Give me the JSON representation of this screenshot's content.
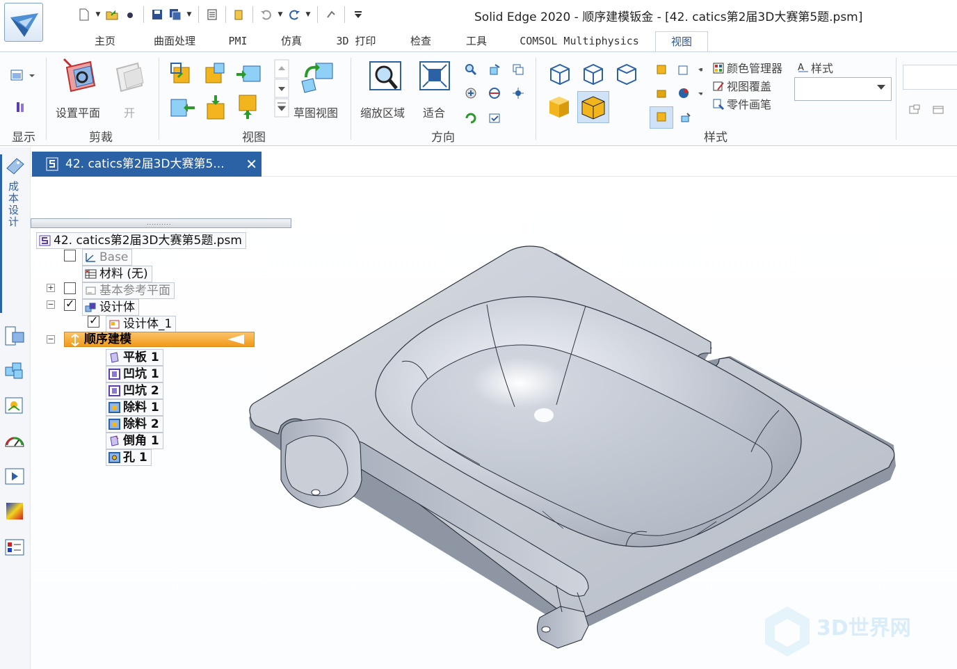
{
  "window": {
    "title": "Solid Edge 2020 - 顺序建模钣金 - [42. catics第2届3D大赛第5题.psm]"
  },
  "ribbon_tabs": [
    {
      "label": "主页"
    },
    {
      "label": "曲面处理"
    },
    {
      "label": "PMI"
    },
    {
      "label": "仿真"
    },
    {
      "label": "3D 打印"
    },
    {
      "label": "检查"
    },
    {
      "label": "工具"
    },
    {
      "label": "COMSOL Multiphysics"
    },
    {
      "label": "视图",
      "active": true
    }
  ],
  "ribbon": {
    "groups": {
      "display": "显示",
      "clip": "剪裁",
      "views": "视图",
      "orient": "方向",
      "style": "样式"
    },
    "buttons": {
      "set_plane": "设置平面",
      "open": "开",
      "sketch_view": "草图视图",
      "zoom_area": "缩放区域",
      "fit": "适合"
    },
    "style_items": {
      "color_manager": "颜色管理器",
      "view_overrides": "视图覆盖",
      "part_painter": "零件画笔",
      "styles": "样式"
    }
  },
  "side_panel": {
    "cost_design": "成本设计"
  },
  "document_tab": {
    "label": "42. catics第2届3D大赛第5..."
  },
  "pathfinder": {
    "root": "42. catics第2届3D大赛第5题.psm",
    "base": "Base",
    "material": "材料 (无)",
    "base_planes": "基本参考平面",
    "design_body": "设计体",
    "design_body_1": "设计体_1",
    "sequential": "顺序建模",
    "features": [
      "平板 1",
      "凹坑 1",
      "凹坑 2",
      "除料 1",
      "除料 2",
      "倒角 1",
      "孔 1"
    ]
  },
  "watermark": {
    "text": "3D世界网"
  },
  "colors": {
    "accent": "#2b62a6",
    "selected_node": "#f4a52a",
    "model_fill": "#c3c8d1"
  }
}
